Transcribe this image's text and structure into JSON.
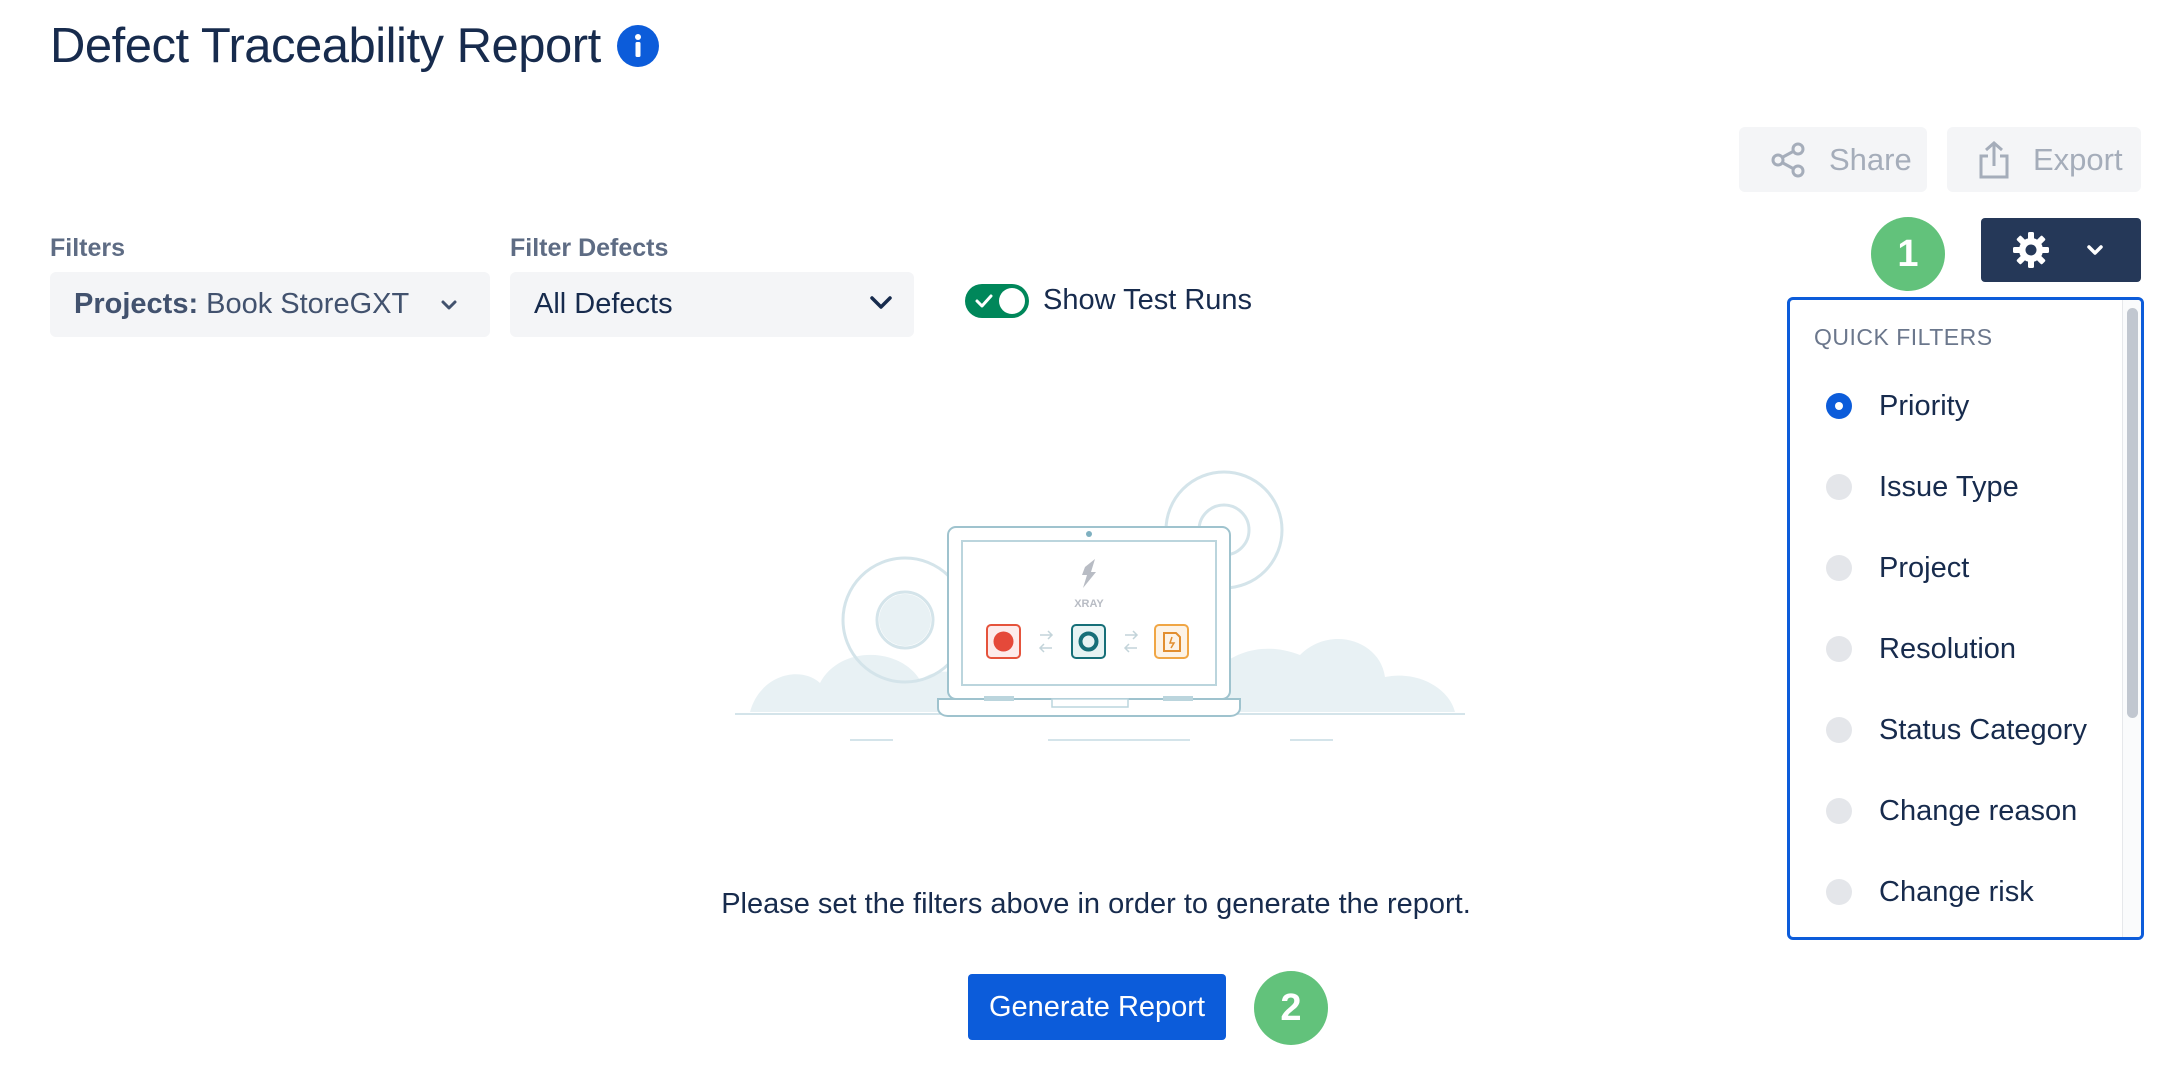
{
  "page": {
    "title": "Defect Traceability Report"
  },
  "toolbar": {
    "share_label": "Share",
    "export_label": "Export"
  },
  "badges": {
    "one": "1",
    "two": "2"
  },
  "filters": {
    "filters_label": "Filters",
    "projects_key": "Projects:",
    "projects_value": "Book StoreGXT",
    "filter_defects_label": "Filter Defects",
    "filter_defects_value": "All Defects",
    "show_test_runs_label": "Show Test Runs",
    "show_test_runs_on": true
  },
  "illustration": {
    "brand_text": "XRAY"
  },
  "main": {
    "empty_message": "Please set the filters above in order to generate the report.",
    "generate_label": "Generate Report"
  },
  "quick_filters": {
    "heading": "QUICK FILTERS",
    "selected": "Priority",
    "items": [
      {
        "label": "Priority"
      },
      {
        "label": "Issue Type"
      },
      {
        "label": "Project"
      },
      {
        "label": "Resolution"
      },
      {
        "label": "Status Category"
      },
      {
        "label": "Change reason"
      },
      {
        "label": "Change risk"
      }
    ]
  },
  "colors": {
    "primary": "#0C5CDA",
    "dark_navy": "#253858",
    "badge_green": "#62C27B",
    "toggle_green": "#00875A"
  }
}
